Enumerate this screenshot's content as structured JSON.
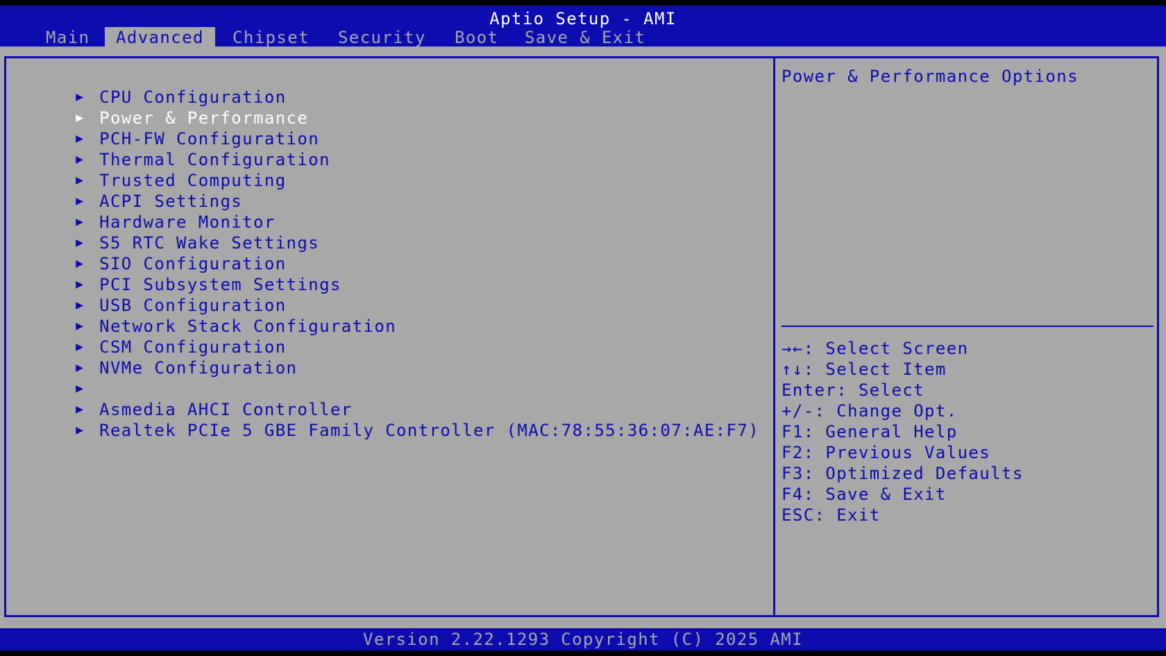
{
  "header": {
    "title": "Aptio Setup - AMI",
    "tabs": [
      {
        "label": "Main"
      },
      {
        "label": "Advanced"
      },
      {
        "label": "Chipset"
      },
      {
        "label": "Security"
      },
      {
        "label": "Boot"
      },
      {
        "label": "Save & Exit"
      }
    ],
    "active_tab": "Advanced"
  },
  "menu": {
    "items": [
      {
        "label": "CPU Configuration"
      },
      {
        "label": "Power & Performance"
      },
      {
        "label": "PCH-FW Configuration"
      },
      {
        "label": "Thermal Configuration"
      },
      {
        "label": "Trusted Computing"
      },
      {
        "label": "ACPI Settings"
      },
      {
        "label": "Hardware Monitor"
      },
      {
        "label": "S5 RTC Wake Settings"
      },
      {
        "label": "SIO Configuration"
      },
      {
        "label": "PCI Subsystem Settings"
      },
      {
        "label": "USB Configuration"
      },
      {
        "label": "Network Stack Configuration"
      },
      {
        "label": "CSM Configuration"
      },
      {
        "label": "NVMe Configuration"
      },
      {
        "label": "Asmedia AHCI Controller"
      },
      {
        "label": "Realtek PCIe 5 GBE Family Controller (MAC:78:55:36:07:AE:F7)"
      }
    ],
    "selected": "Power & Performance",
    "arrow_glyph": "▶"
  },
  "help": {
    "title": "Power & Performance Options",
    "keys": [
      {
        "text": "→←: Select Screen"
      },
      {
        "text": "↑↓: Select Item"
      },
      {
        "text": "Enter: Select"
      },
      {
        "text": "+/-: Change Opt."
      },
      {
        "text": "F1: General Help"
      },
      {
        "text": "F2: Previous Values"
      },
      {
        "text": "F3: Optimized Defaults"
      },
      {
        "text": "F4: Save & Exit"
      },
      {
        "text": "ESC: Exit"
      }
    ]
  },
  "footer": {
    "version": "Version 2.22.1293 Copyright (C) 2025 AMI"
  },
  "colors": {
    "background": "#a8a8a8",
    "accent": "#0c0caf",
    "highlight": "#ffffff"
  }
}
